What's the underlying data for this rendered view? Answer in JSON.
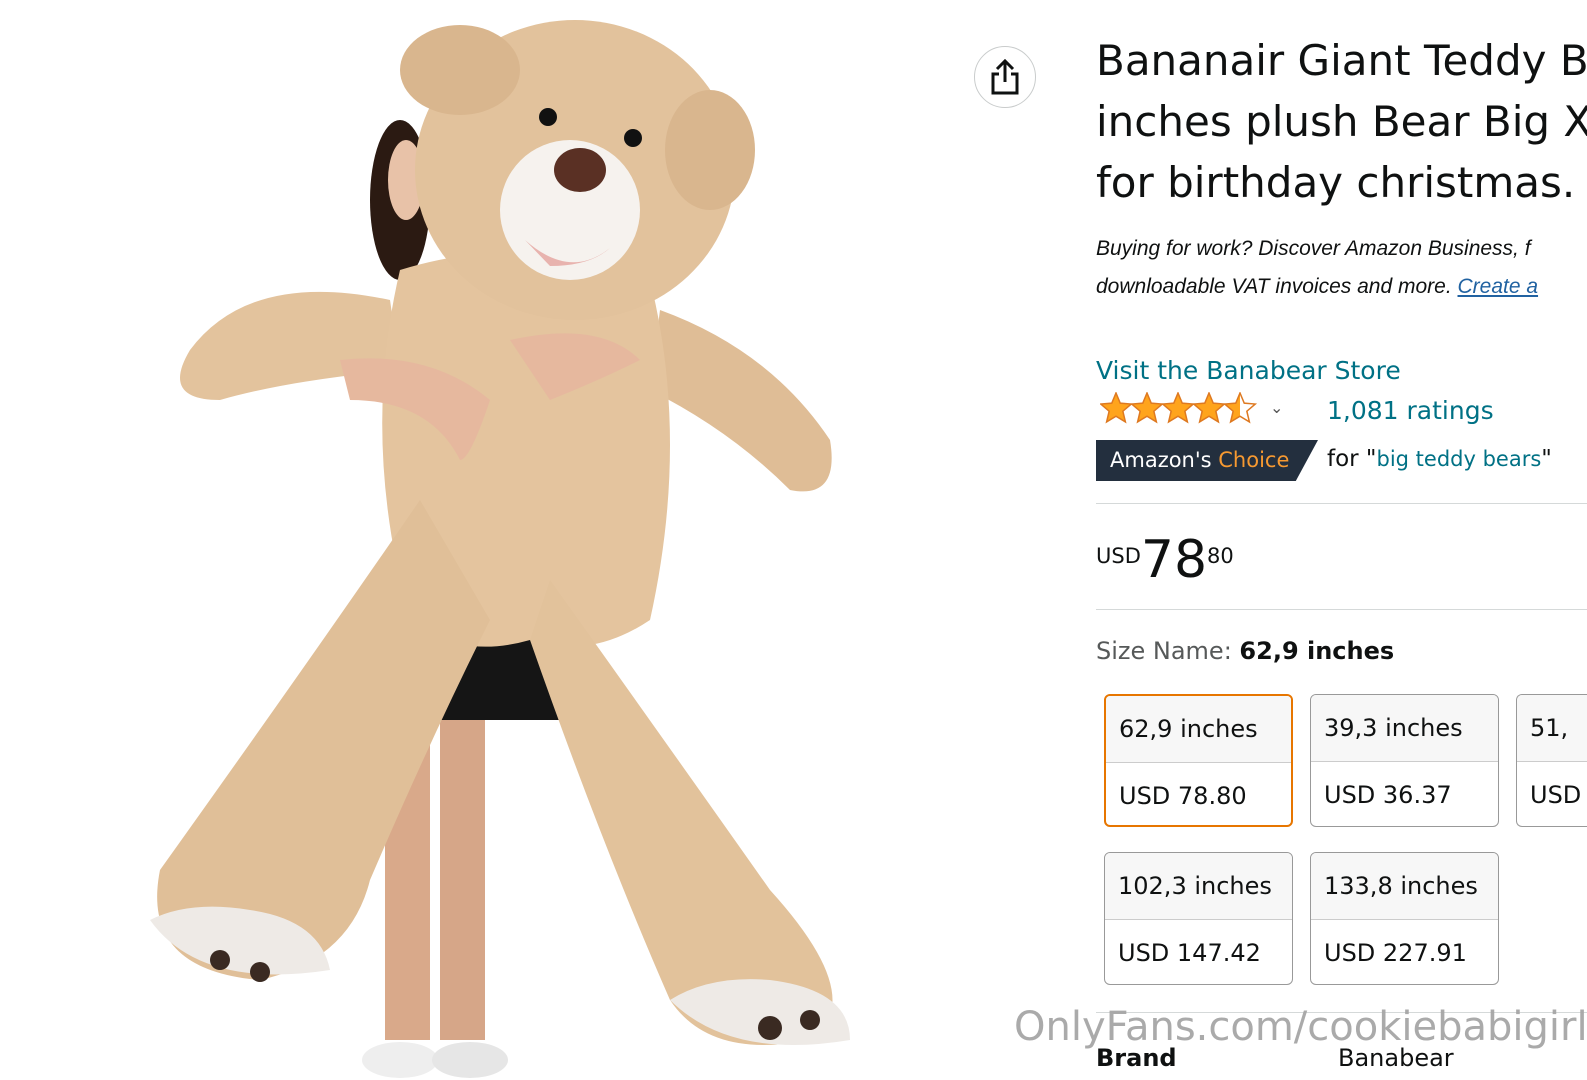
{
  "product": {
    "title_lines": [
      "Bananair Giant Teddy B",
      "inches plush Bear Big X",
      "for birthday christmas."
    ],
    "business_line1": "Buying for work? Discover Amazon Business, f",
    "business_line2": "downloadable VAT invoices and more. ",
    "business_link": "Create a",
    "store_link": "Visit the Banabear Store",
    "rating_stars": 4.5,
    "ratings_count": "1,081 ratings",
    "badge_prefix": "Amazon's ",
    "badge_highlight": "Choice",
    "badge_for": "for \"",
    "badge_keyword": "big teddy bears",
    "badge_close": "\"",
    "price_currency": "USD",
    "price_whole": "78",
    "price_fraction": "80",
    "size_label": "Size Name: ",
    "size_selected": "62,9 inches",
    "size_options": [
      {
        "name": "62,9 inches",
        "price": "USD 78.80"
      },
      {
        "name": "39,3 inches",
        "price": "USD 36.37"
      },
      {
        "name": "51,",
        "price": "USD"
      },
      {
        "name": "102,3 inches",
        "price": "USD 147.42"
      },
      {
        "name": "133,8 inches",
        "price": "USD 227.91"
      }
    ],
    "brand_label": "Brand",
    "brand_value": "Banabear"
  },
  "watermark": "OnlyFans.com/cookiebabigirl",
  "icons": {
    "share": "share-icon",
    "stars": "star-rating-icon",
    "chevron": "chevron-down-icon"
  },
  "colors": {
    "link": "#007185",
    "badge_bg": "#232f3e",
    "badge_orange": "#f69931",
    "selected_border": "#e77600",
    "star": "#ffa41c"
  }
}
